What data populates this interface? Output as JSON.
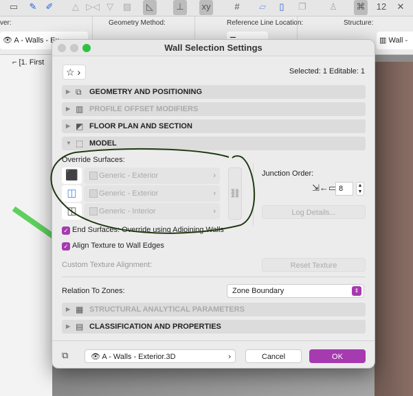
{
  "toolbar": {
    "icons": [
      "story-icon",
      "eyedropper-icon",
      "syringe-icon",
      "triangle-up-icon",
      "mirror-icon",
      "triangle-down-icon",
      "hatch-icon",
      "angle-icon",
      "snap-icon",
      "xy-icon",
      "grid-icon",
      "plane-icon",
      "wall-icon",
      "layer-icon",
      "person-icon",
      "camera-icon",
      "number-icon",
      "close-icon"
    ]
  },
  "infobar": {
    "layer_label": "ver:",
    "layer_value": "A - Walls - Ex",
    "geometry_label": "Geometry Method:",
    "refline_label": "Reference Line Location:",
    "structure_label": "Structure:",
    "structure_value": "Wall -"
  },
  "navigator": {
    "item": "[1. First"
  },
  "dialog": {
    "title": "Wall Selection Settings",
    "selected_info": "Selected: 1 Editable: 1",
    "sections": [
      {
        "label": "GEOMETRY AND POSITIONING",
        "disabled": false,
        "expanded": false
      },
      {
        "label": "PROFILE OFFSET MODIFIERS",
        "disabled": true,
        "expanded": false
      },
      {
        "label": "FLOOR PLAN AND SECTION",
        "disabled": false,
        "expanded": false
      },
      {
        "label": "MODEL",
        "disabled": false,
        "expanded": true
      },
      {
        "label": "STRUCTURAL ANALYTICAL PARAMETERS",
        "disabled": true,
        "expanded": false
      },
      {
        "label": "CLASSIFICATION AND PROPERTIES",
        "disabled": false,
        "expanded": false
      }
    ],
    "model": {
      "override_label": "Override Surfaces:",
      "surfaces": [
        "Generic - Exterior",
        "Generic - Exterior",
        "Generic - Interior"
      ],
      "junction_label": "Junction Order:",
      "junction_value": "8",
      "log_details": "Log Details...",
      "end_surfaces": "End Surfaces: Override using Adjoining Walls",
      "align_texture": "Align Texture to Wall Edges",
      "custom_texture_label": "Custom Texture Alignment:",
      "reset_texture": "Reset Texture",
      "zones_label": "Relation To Zones:",
      "zones_value": "Zone Boundary"
    },
    "footer": {
      "layer": "A - Walls - Exterior.3D",
      "cancel": "Cancel",
      "ok": "OK"
    }
  },
  "colors": {
    "accent": "#a63ab0",
    "annotation": "#1f3a12"
  }
}
